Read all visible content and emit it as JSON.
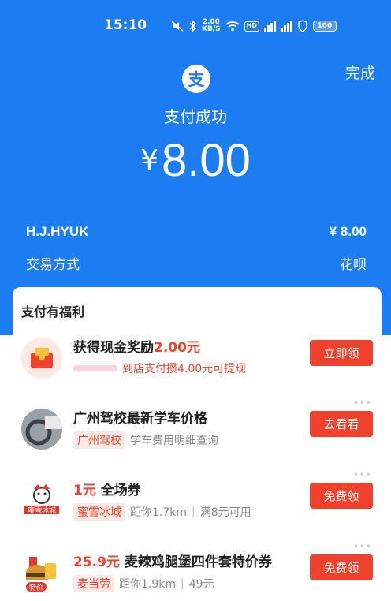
{
  "status_bar": {
    "time": "15:10",
    "net_speed_top": "2.00",
    "net_speed_bottom": "KB/S",
    "hd_label": "HD",
    "sim_label": "4G",
    "battery": "100"
  },
  "header": {
    "done_label": "完成",
    "logo_glyph": "支",
    "pay_status": "支付成功",
    "currency": "¥",
    "amount": "8.00"
  },
  "details": {
    "merchant": "H.J.HYUK",
    "merchant_amount": "¥ 8.00",
    "method_label": "交易方式",
    "method_value": "花呗"
  },
  "benefits": {
    "title": "支付有福利",
    "items": [
      {
        "title_prefix": "获得现金奖励",
        "title_highlight": "2.00元",
        "subtitle": "到店支付攒4.00元可提现",
        "cta": "立即领"
      },
      {
        "title": "广州驾校最新学车价格",
        "tag": "广州驾校",
        "subtitle": "学车费用明细查询",
        "cta": "去看看"
      },
      {
        "title_highlight": "1元",
        "title_suffix": "全场券",
        "tag": "蜜雪冰城",
        "distance": "距你1.7km",
        "separator": "|",
        "condition": "满8元可用",
        "cta": "免费领",
        "logo_text": "蜜雪冰城"
      },
      {
        "title_highlight": "25.9元",
        "title_suffix": "麦辣鸡腿堡四件套特价券",
        "tag": "麦当劳",
        "distance": "距你1.9km",
        "separator": "|",
        "original_price": "49元",
        "cta": "免费领",
        "badge": "特价"
      }
    ]
  },
  "colors": {
    "brand_blue": "#1c7cf2",
    "accent_red": "#f0412c"
  }
}
